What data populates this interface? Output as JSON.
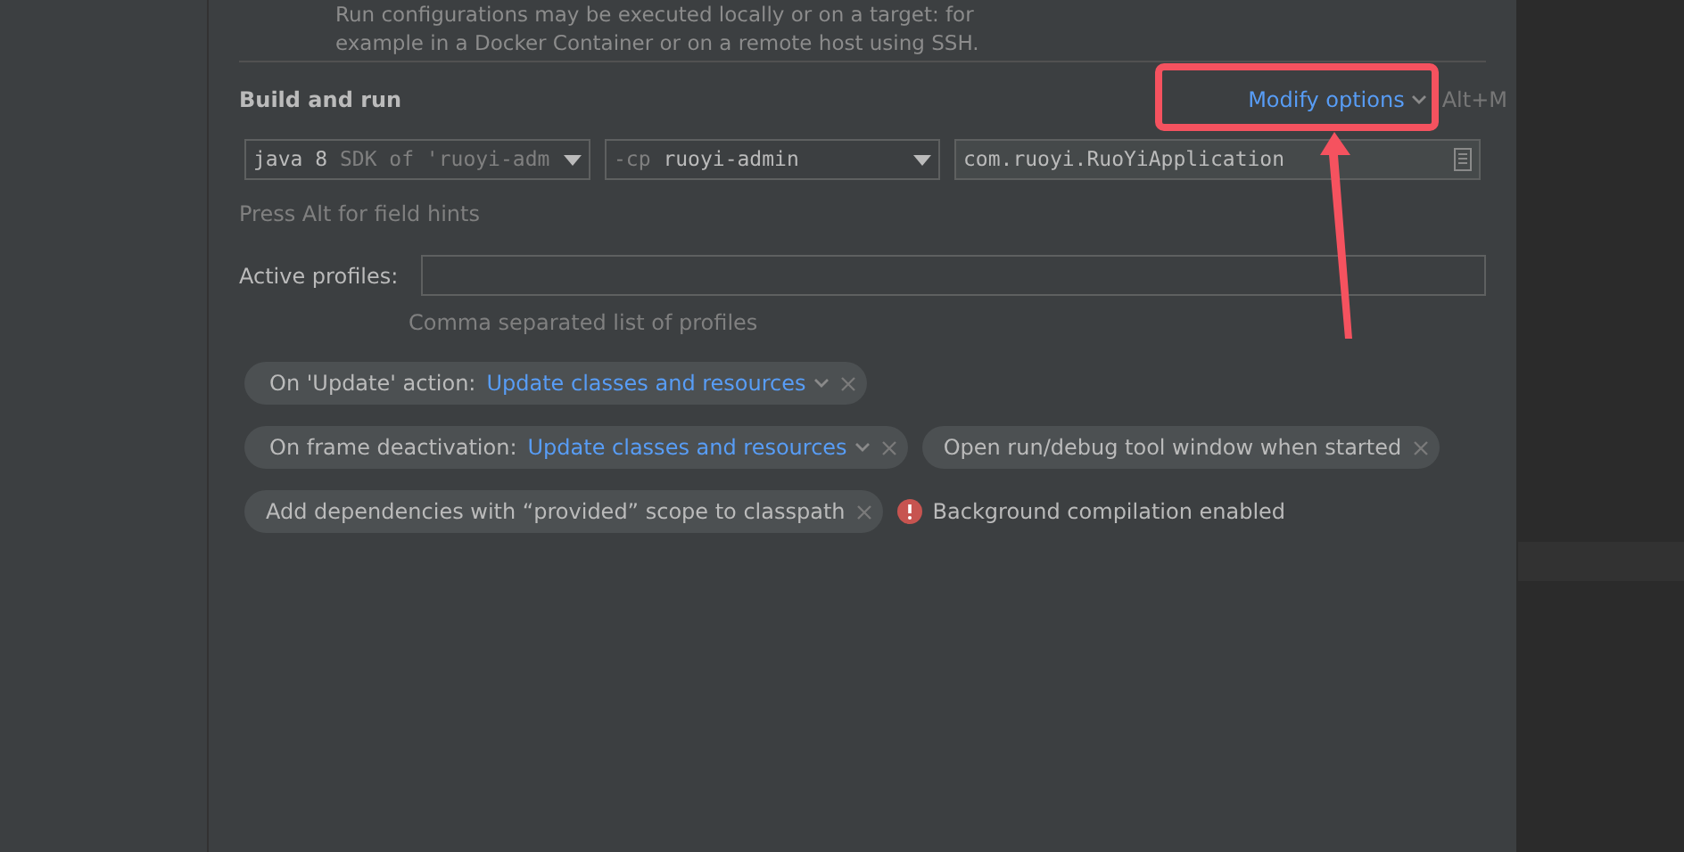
{
  "intro_text": "Run configurations may be executed locally or on a target: for\nexample in a Docker Container or on a remote host using SSH.",
  "section_title": "Build and run",
  "modify_options": {
    "label": "Modify options",
    "shortcut": "Alt+M"
  },
  "jre_combo": {
    "value": "java 8",
    "hint": "SDK of 'ruoyi-adm"
  },
  "classpath_combo": {
    "prefix": "-cp",
    "value": "ruoyi-admin"
  },
  "main_class_field": {
    "value": "com.ruoyi.RuoYiApplication"
  },
  "field_hint": "Press Alt for field hints",
  "active_profiles": {
    "label": "Active profiles:",
    "hint": "Comma separated list of profiles"
  },
  "option_rows": [
    [
      {
        "kind": "choice",
        "label": "On 'Update' action:",
        "value": "Update classes and resources"
      }
    ],
    [
      {
        "kind": "choice",
        "label": "On frame deactivation:",
        "value": "Update classes and resources"
      },
      {
        "kind": "plain",
        "label": "Open run/debug tool window when started"
      }
    ],
    [
      {
        "kind": "plain",
        "label": "Add dependencies with “provided” scope to classpath"
      },
      {
        "kind": "warning",
        "label": "Background compilation enabled"
      }
    ]
  ]
}
